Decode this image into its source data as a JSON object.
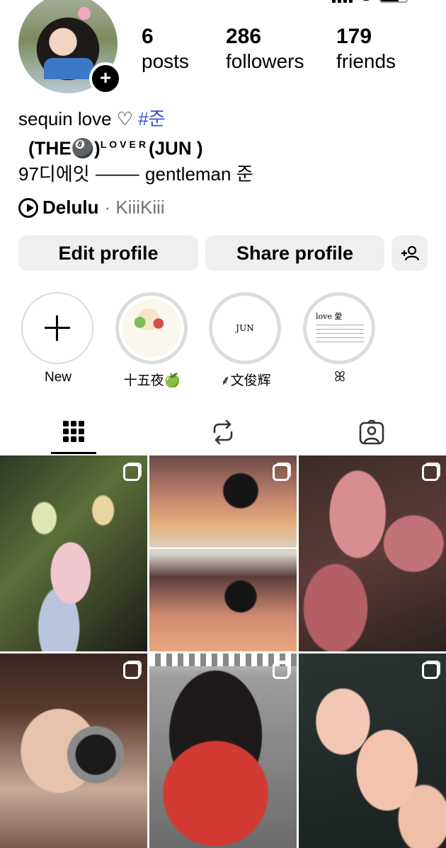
{
  "profile": {
    "stats": [
      {
        "value": "6",
        "label": "posts"
      },
      {
        "value": "286",
        "label": "followers"
      },
      {
        "value": "179",
        "label": "friends"
      }
    ],
    "bio_line1_text": "sequin love ♡ ",
    "bio_line1_tag": "#준",
    "bio_line2_a": "(THE🎱)",
    "bio_line2_small": "LOVER",
    "bio_line2_b": "(JUN )",
    "bio_line3": "97디에잇  ⸻ gentleman 준",
    "music_song": "Delulu",
    "music_artist": "· KiiiKiii"
  },
  "buttons": {
    "edit": "Edit profile",
    "share": "Share profile"
  },
  "highlights": [
    {
      "label": "New"
    },
    {
      "label": "十五夜🍏"
    },
    {
      "label": "⸙文俊辉",
      "cover_text": "JUN"
    },
    {
      "label": "ꕤ",
      "cover_text": "love 愛"
    }
  ],
  "icons": {
    "grid_tab": "grid-icon",
    "reels_tab": "repost-icon",
    "tagged_tab": "tagged-icon",
    "add_person": "add-person-icon",
    "multi_post": "carousel-icon"
  },
  "colors": {
    "accent_tag": "#3550d6",
    "button_bg": "#efefef",
    "secondary_text": "#737373"
  }
}
